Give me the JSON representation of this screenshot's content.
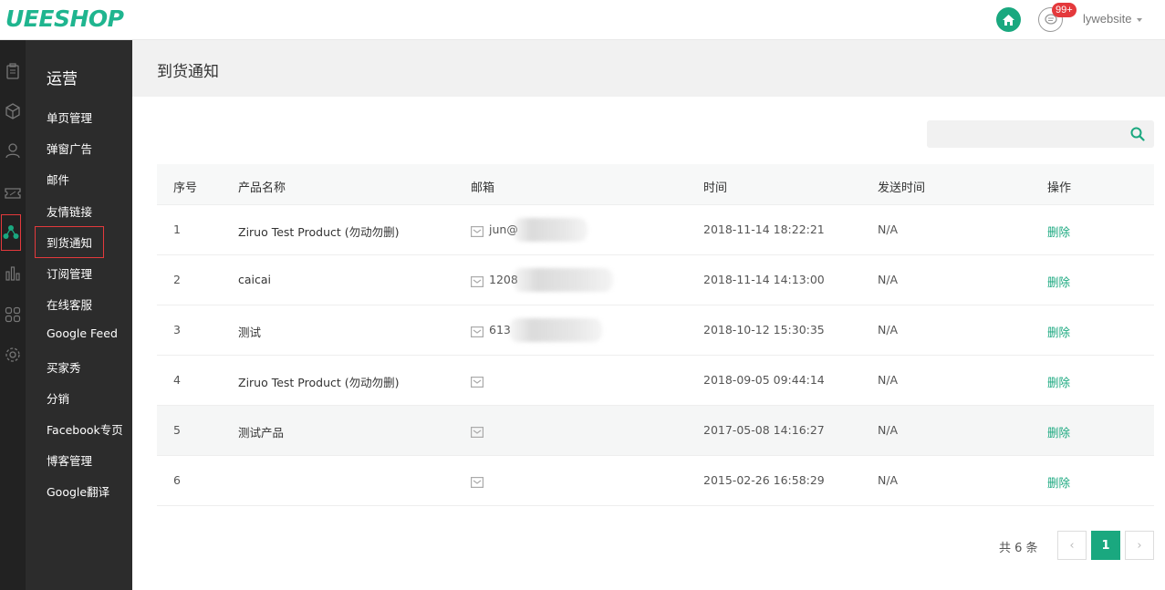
{
  "app": {
    "logo": "UEESHOP"
  },
  "topbar": {
    "badge": "99+",
    "username": "lywebsite",
    "accent": "#1aa87f"
  },
  "rail": {
    "icons": [
      "clipboard-icon",
      "box-icon",
      "user-icon",
      "coupon-icon",
      "share-icon",
      "bar-chart-icon",
      "apps-icon",
      "settings-icon"
    ],
    "active_icon": "share-icon"
  },
  "sidebar": {
    "title": "运营",
    "items": [
      {
        "label": "单页管理"
      },
      {
        "label": "弹窗广告"
      },
      {
        "label": "邮件"
      },
      {
        "label": "友情链接"
      },
      {
        "label": "到货通知"
      },
      {
        "label": "订阅管理"
      },
      {
        "label": "在线客服"
      },
      {
        "label": "Google Feed"
      },
      {
        "label": "买家秀"
      },
      {
        "label": "分销"
      },
      {
        "label": "Facebook专页"
      },
      {
        "label": "博客管理"
      },
      {
        "label": "Google翻译"
      }
    ],
    "active_label": "到货通知"
  },
  "page": {
    "title": "到货通知"
  },
  "search": {
    "placeholder": ""
  },
  "table": {
    "headers": {
      "index": "序号",
      "product": "产品名称",
      "email": "邮箱",
      "time": "时间",
      "sent_time": "发送时间",
      "action": "操作"
    },
    "rows": [
      {
        "index": "1",
        "product": "Ziruo Test Product (勿动勿删)",
        "email": "jun@",
        "time": "2018-11-14 18:22:21",
        "sent_time": "N/A",
        "action": "删除"
      },
      {
        "index": "2",
        "product": "caicai",
        "email": "1208",
        "time": "2018-11-14 14:13:00",
        "sent_time": "N/A",
        "action": "删除"
      },
      {
        "index": "3",
        "product": "测试",
        "email": "613",
        "time": "2018-10-12 15:30:35",
        "sent_time": "N/A",
        "action": "删除"
      },
      {
        "index": "4",
        "product": "Ziruo Test Product (勿动勿删)",
        "email": "",
        "time": "2018-09-05 09:44:14",
        "sent_time": "N/A",
        "action": "删除"
      },
      {
        "index": "5",
        "product": "测试产品",
        "email": "",
        "time": "2017-05-08 14:16:27",
        "sent_time": "N/A",
        "action": "删除"
      },
      {
        "index": "6",
        "product": "",
        "email": "",
        "time": "2015-02-26 16:58:29",
        "sent_time": "N/A",
        "action": "删除"
      }
    ]
  },
  "pagination": {
    "total": "共 6 条",
    "prev": "‹",
    "current": "1",
    "next": "›"
  }
}
